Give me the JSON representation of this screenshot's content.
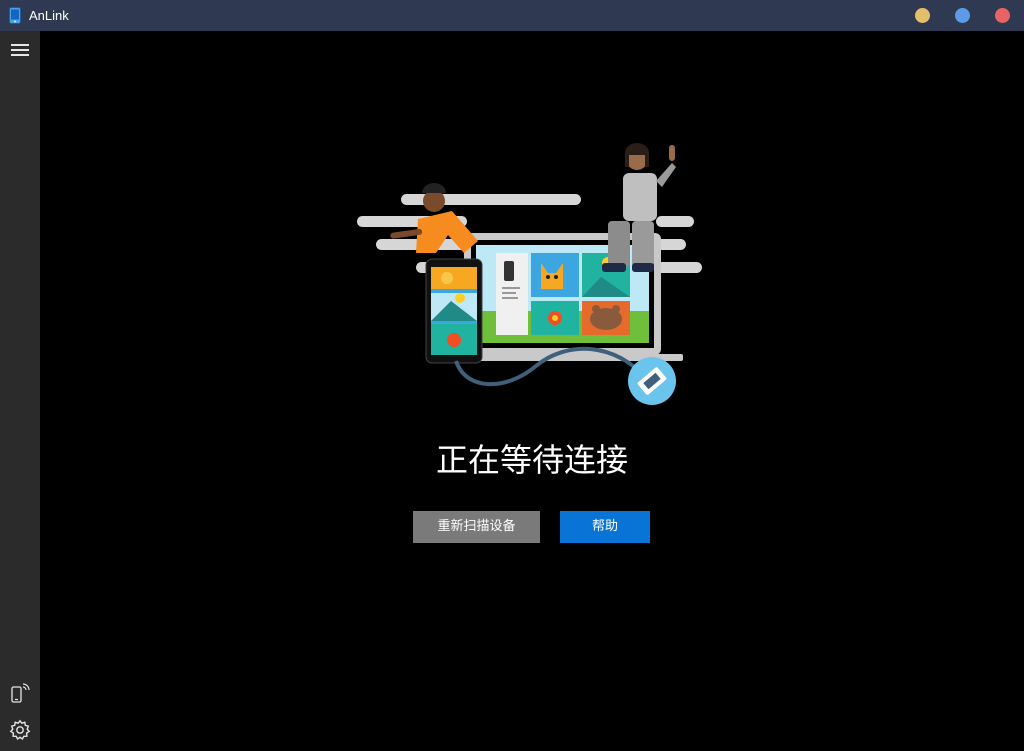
{
  "window": {
    "title": "AnLink",
    "controls": {
      "minimize_color": "#e5be6a",
      "maximize_color": "#5b9bea",
      "close_color": "#e86464"
    }
  },
  "sidebar": {
    "menu_icon": "hamburger-menu-icon",
    "device_icon": "phone-wireless-icon",
    "settings_icon": "gear-icon"
  },
  "main": {
    "status_title": "正在等待连接",
    "rescan_button": "重新扫描设备",
    "help_button": "帮助"
  },
  "colors": {
    "titlebar": "#2f3a52",
    "sidebar": "#2b2b2b",
    "background": "#000000",
    "rescan_button": "#7a7a7a",
    "help_button": "#0a74d6"
  }
}
